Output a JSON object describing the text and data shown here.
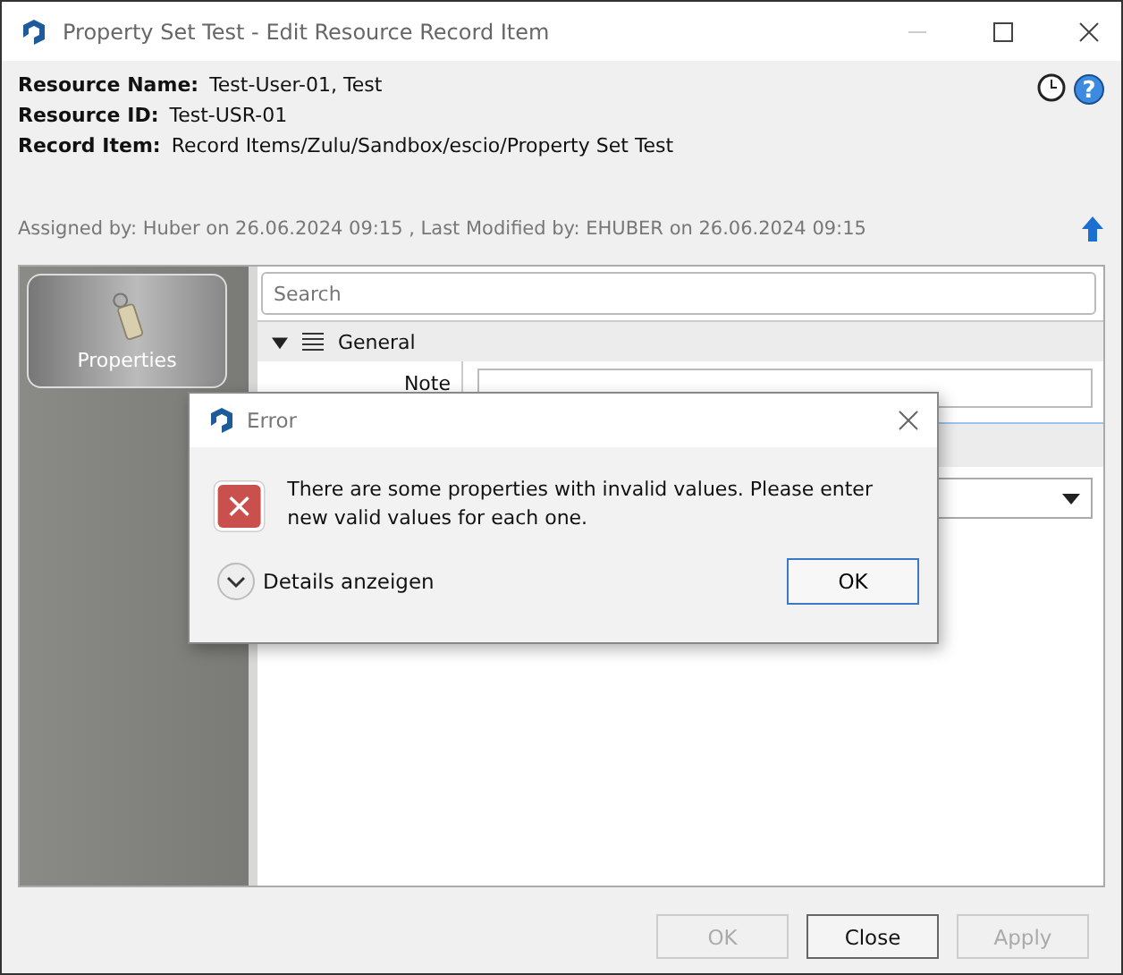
{
  "window": {
    "title": "Property Set Test - Edit Resource Record Item"
  },
  "header": {
    "fields": [
      {
        "label": "Resource Name:",
        "value": "Test-User-01, Test"
      },
      {
        "label": "Resource ID:",
        "value": "Test-USR-01"
      },
      {
        "label": "Record Item:",
        "value": "Record Items/Zulu/Sandbox/escio/Property Set Test"
      }
    ],
    "help_glyph": "?",
    "audit": "Assigned by: Huber on 26.06.2024 09:15 ,  Last Modified by: EHUBER on 26.06.2024 09:15"
  },
  "sidebar": {
    "items": [
      {
        "label": "Properties",
        "selected": true
      }
    ]
  },
  "search": {
    "placeholder": "Search"
  },
  "section": {
    "title": "General",
    "expanded": true,
    "rows": [
      {
        "label": "Note"
      }
    ]
  },
  "dialog": {
    "title": "Error",
    "message": "There are some properties with invalid values. Please enter new valid values for each one.",
    "details": "Details anzeigen",
    "button": "OK"
  },
  "buttons": [
    {
      "label": "OK",
      "disabled": true
    },
    {
      "label": "Close",
      "disabled": false
    },
    {
      "label": "Apply",
      "disabled": true
    }
  ]
}
